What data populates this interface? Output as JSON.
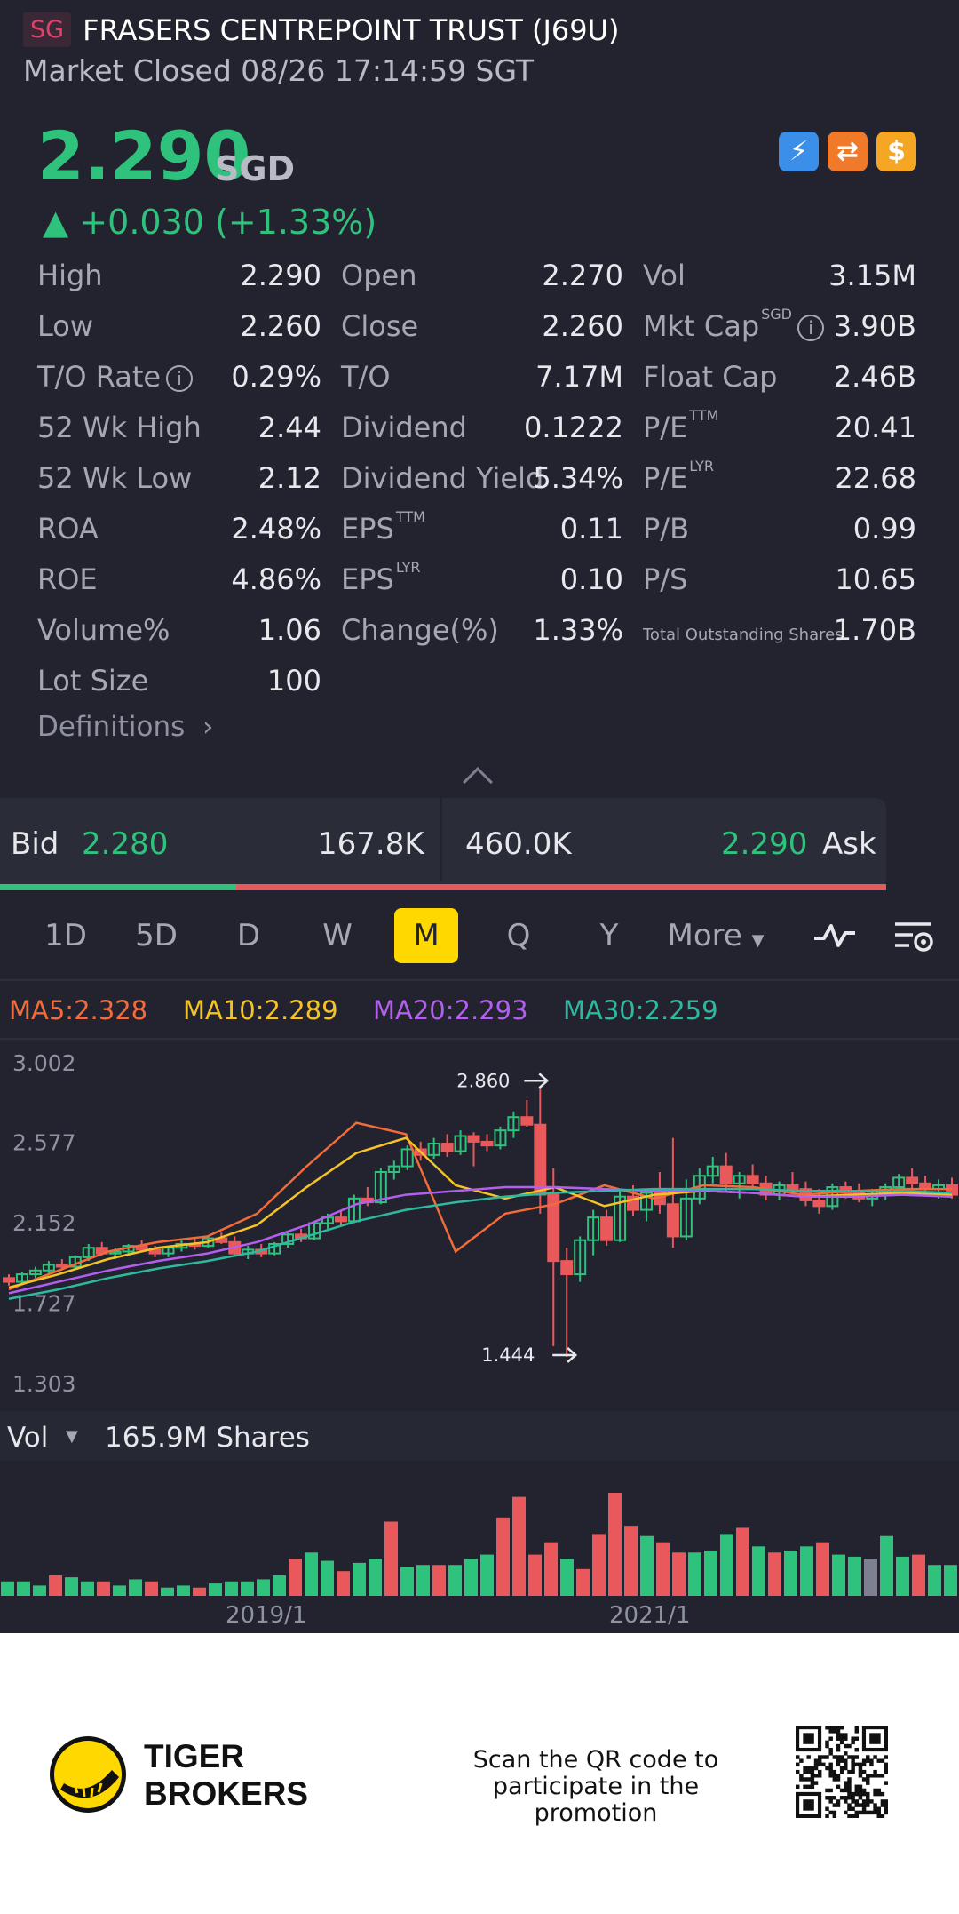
{
  "header": {
    "region": "SG",
    "name": "FRASERS CENTREPOINT TRUST (J69U)",
    "status": "Market Closed 08/26 17:14:59 SGT"
  },
  "quote": {
    "price": "2.290",
    "currency": "SGD",
    "change": "▲ +0.030 (+1.33%)",
    "color_up": "#2fc27d",
    "color_down": "#e9585a"
  },
  "badges": [
    {
      "icon": "lightning-1-icon",
      "glyph": "⚡",
      "color": "#3b8fe8"
    },
    {
      "icon": "swap-icon",
      "glyph": "⇄",
      "color": "#f07a2a"
    },
    {
      "icon": "dollar-icon",
      "glyph": "$",
      "color": "#f5a623"
    }
  ],
  "stats": [
    [
      {
        "l": "High",
        "v": "2.290"
      },
      {
        "l": "Open",
        "v": "2.270"
      },
      {
        "l": "Vol",
        "v": "3.15M"
      }
    ],
    [
      {
        "l": "Low",
        "v": "2.260"
      },
      {
        "l": "Close",
        "v": "2.260"
      },
      {
        "l": "Mkt Cap",
        "sup": "SGD",
        "info": true,
        "v": "3.90B"
      }
    ],
    [
      {
        "l": "T/O Rate",
        "info": true,
        "v": "0.29%"
      },
      {
        "l": "T/O",
        "v": "7.17M"
      },
      {
        "l": "Float Cap",
        "v": "2.46B"
      }
    ],
    [
      {
        "l": "52 Wk High",
        "v": "2.44"
      },
      {
        "l": "Dividend",
        "v": "0.1222"
      },
      {
        "l": "P/E",
        "sup": "TTM",
        "v": "20.41"
      }
    ],
    [
      {
        "l": "52 Wk Low",
        "v": "2.12"
      },
      {
        "l": "Dividend Yield",
        "v": "5.34%"
      },
      {
        "l": "P/E",
        "sup": "LYR",
        "v": "22.68"
      }
    ],
    [
      {
        "l": "ROA",
        "v": "2.48%"
      },
      {
        "l": "EPS",
        "sup": "TTM",
        "v": "0.11"
      },
      {
        "l": "P/B",
        "v": "0.99"
      }
    ],
    [
      {
        "l": "ROE",
        "v": "4.86%"
      },
      {
        "l": "EPS",
        "sup": "LYR",
        "v": "0.10"
      },
      {
        "l": "P/S",
        "v": "10.65"
      }
    ],
    [
      {
        "l": "Volume%",
        "v": "1.06"
      },
      {
        "l": "Change(%)",
        "v": "1.33%"
      },
      {
        "l": "Total Outstanding Shares",
        "small": true,
        "v": "1.70B"
      }
    ],
    [
      {
        "l": "Lot Size",
        "v": "100"
      }
    ]
  ],
  "definitions_label": "Definitions",
  "bidask": {
    "bid_label": "Bid",
    "bid_price": "2.280",
    "bid_size": "167.8K",
    "ask_size": "460.0K",
    "ask_price": "2.290",
    "ask_label": "Ask",
    "bid_ratio": 0.267
  },
  "tabs": [
    "1D",
    "5D",
    "D",
    "W",
    "M",
    "Q",
    "Y"
  ],
  "active_tab": "M",
  "more_label": "More",
  "ma": [
    {
      "text": "MA5:2.328",
      "color": "#f26b3a"
    },
    {
      "text": "MA10:2.289",
      "color": "#f5c326"
    },
    {
      "text": "MA20:2.293",
      "color": "#b45ef0"
    },
    {
      "text": "MA30:2.259",
      "color": "#2fb8a0"
    }
  ],
  "chart_data": {
    "type": "candlestick",
    "y_ticks": [
      "3.002",
      "2.577",
      "2.152",
      "1.727",
      "1.303"
    ],
    "ylim": [
      1.303,
      3.002
    ],
    "x_ticks": [
      "2019/1",
      "2021/1"
    ],
    "high_marker": "2.860",
    "low_marker": "1.444",
    "candles": [
      [
        1.86,
        1.88,
        1.82,
        1.84
      ],
      [
        1.84,
        1.89,
        1.83,
        1.88
      ],
      [
        1.88,
        1.92,
        1.86,
        1.9
      ],
      [
        1.9,
        1.95,
        1.88,
        1.93
      ],
      [
        1.93,
        1.96,
        1.9,
        1.92
      ],
      [
        1.92,
        1.98,
        1.91,
        1.97
      ],
      [
        1.97,
        2.04,
        1.95,
        2.02
      ],
      [
        2.02,
        2.05,
        1.98,
        1.99
      ],
      [
        1.99,
        2.02,
        1.96,
        2.0
      ],
      [
        2.0,
        2.04,
        1.98,
        2.03
      ],
      [
        2.03,
        2.06,
        2.0,
        2.01
      ],
      [
        2.01,
        2.03,
        1.97,
        1.99
      ],
      [
        1.99,
        2.03,
        1.97,
        2.02
      ],
      [
        2.02,
        2.06,
        2.0,
        2.04
      ],
      [
        2.04,
        2.07,
        2.01,
        2.03
      ],
      [
        2.03,
        2.08,
        2.02,
        2.07
      ],
      [
        2.07,
        2.1,
        2.04,
        2.05
      ],
      [
        2.05,
        2.08,
        1.98,
        1.99
      ],
      [
        1.99,
        2.03,
        1.96,
        2.01
      ],
      [
        2.01,
        2.04,
        1.97,
        1.99
      ],
      [
        1.99,
        2.05,
        1.98,
        2.04
      ],
      [
        2.04,
        2.1,
        2.02,
        2.09
      ],
      [
        2.09,
        2.12,
        2.05,
        2.07
      ],
      [
        2.07,
        2.16,
        2.06,
        2.15
      ],
      [
        2.15,
        2.2,
        2.12,
        2.18
      ],
      [
        2.18,
        2.22,
        2.14,
        2.16
      ],
      [
        2.16,
        2.3,
        2.15,
        2.28
      ],
      [
        2.28,
        2.34,
        2.24,
        2.26
      ],
      [
        2.26,
        2.44,
        2.25,
        2.42
      ],
      [
        2.42,
        2.48,
        2.38,
        2.45
      ],
      [
        2.45,
        2.56,
        2.43,
        2.54
      ],
      [
        2.54,
        2.58,
        2.48,
        2.51
      ],
      [
        2.51,
        2.6,
        2.49,
        2.57
      ],
      [
        2.57,
        2.62,
        2.5,
        2.53
      ],
      [
        2.53,
        2.64,
        2.51,
        2.61
      ],
      [
        2.61,
        2.63,
        2.45,
        2.58
      ],
      [
        2.58,
        2.62,
        2.53,
        2.56
      ],
      [
        2.56,
        2.66,
        2.54,
        2.64
      ],
      [
        2.64,
        2.74,
        2.6,
        2.71
      ],
      [
        2.71,
        2.8,
        2.66,
        2.67
      ],
      [
        2.67,
        2.86,
        2.2,
        2.3
      ],
      [
        2.3,
        2.44,
        1.5,
        1.95
      ],
      [
        1.95,
        2.02,
        1.444,
        1.88
      ],
      [
        1.88,
        2.08,
        1.84,
        2.06
      ],
      [
        2.06,
        2.22,
        1.98,
        2.18
      ],
      [
        2.18,
        2.22,
        2.03,
        2.06
      ],
      [
        2.06,
        2.32,
        2.05,
        2.29
      ],
      [
        2.29,
        2.35,
        2.19,
        2.22
      ],
      [
        2.22,
        2.33,
        2.16,
        2.31
      ],
      [
        2.31,
        2.42,
        2.2,
        2.25
      ],
      [
        2.25,
        2.6,
        2.02,
        2.08
      ],
      [
        2.08,
        2.38,
        2.06,
        2.28
      ],
      [
        2.28,
        2.44,
        2.25,
        2.4
      ],
      [
        2.4,
        2.5,
        2.36,
        2.45
      ],
      [
        2.45,
        2.52,
        2.32,
        2.36
      ],
      [
        2.36,
        2.42,
        2.28,
        2.4
      ],
      [
        2.4,
        2.46,
        2.34,
        2.36
      ],
      [
        2.36,
        2.4,
        2.27,
        2.3
      ],
      [
        2.3,
        2.37,
        2.27,
        2.35
      ],
      [
        2.35,
        2.42,
        2.3,
        2.33
      ],
      [
        2.33,
        2.37,
        2.24,
        2.27
      ],
      [
        2.27,
        2.33,
        2.2,
        2.24
      ],
      [
        2.24,
        2.36,
        2.22,
        2.34
      ],
      [
        2.34,
        2.37,
        2.28,
        2.31
      ],
      [
        2.31,
        2.36,
        2.26,
        2.28
      ],
      [
        2.28,
        2.33,
        2.24,
        2.3
      ],
      [
        2.3,
        2.36,
        2.27,
        2.34
      ],
      [
        2.34,
        2.41,
        2.31,
        2.39
      ],
      [
        2.39,
        2.44,
        2.33,
        2.36
      ],
      [
        2.36,
        2.4,
        2.31,
        2.33
      ],
      [
        2.33,
        2.38,
        2.28,
        2.35
      ],
      [
        2.35,
        2.39,
        2.28,
        2.3
      ]
    ],
    "ma_series": [
      {
        "name": "MA5",
        "color": "#f26b3a",
        "values": [
          1.8,
          1.9,
          2.0,
          2.05,
          2.08,
          2.2,
          2.45,
          2.68,
          2.62,
          2.0,
          2.2,
          2.25,
          2.35,
          2.28,
          2.35,
          2.34,
          2.3,
          2.32,
          2.33,
          2.33
        ]
      },
      {
        "name": "MA10",
        "color": "#f5c326",
        "values": [
          1.81,
          1.88,
          1.96,
          2.02,
          2.05,
          2.14,
          2.34,
          2.52,
          2.6,
          2.35,
          2.28,
          2.34,
          2.24,
          2.3,
          2.32,
          2.31,
          2.29,
          2.3,
          2.31,
          2.3
        ]
      },
      {
        "name": "MA20",
        "color": "#b45ef0",
        "values": [
          1.78,
          1.84,
          1.9,
          1.95,
          1.99,
          2.05,
          2.14,
          2.25,
          2.3,
          2.32,
          2.34,
          2.34,
          2.33,
          2.32,
          2.32,
          2.31,
          2.29,
          2.29,
          2.3,
          2.29
        ]
      },
      {
        "name": "MA30",
        "color": "#2fb8a0",
        "values": [
          1.75,
          1.8,
          1.86,
          1.91,
          1.95,
          2.0,
          2.08,
          2.16,
          2.22,
          2.26,
          2.29,
          2.31,
          2.32,
          2.33,
          2.33,
          2.33,
          2.32,
          2.32,
          2.32,
          2.31
        ]
      }
    ]
  },
  "volume": {
    "label": "Vol",
    "value_text": "165.9M Shares",
    "bars": [
      0.14,
      0.14,
      0.1,
      0.2,
      0.18,
      0.14,
      0.14,
      0.1,
      0.16,
      0.14,
      0.08,
      0.1,
      0.08,
      0.12,
      0.14,
      0.14,
      0.16,
      0.2,
      0.36,
      0.42,
      0.34,
      0.24,
      0.32,
      0.36,
      0.72,
      0.28,
      0.3,
      0.3,
      0.3,
      0.36,
      0.4,
      0.76,
      0.96,
      0.4,
      0.52,
      0.36,
      0.26,
      0.6,
      1.0,
      0.68,
      0.58,
      0.52,
      0.42,
      0.42,
      0.44,
      0.6,
      0.66,
      0.48,
      0.42,
      0.44,
      0.48,
      0.52,
      0.4,
      0.38,
      0.36,
      0.58,
      0.38,
      0.4,
      0.3,
      0.3
    ],
    "grey_index": 54
  },
  "footer": {
    "brand_line1": "TIGER",
    "brand_line2": "BROKERS",
    "promo": "Scan the QR code to participate in the promotion"
  }
}
